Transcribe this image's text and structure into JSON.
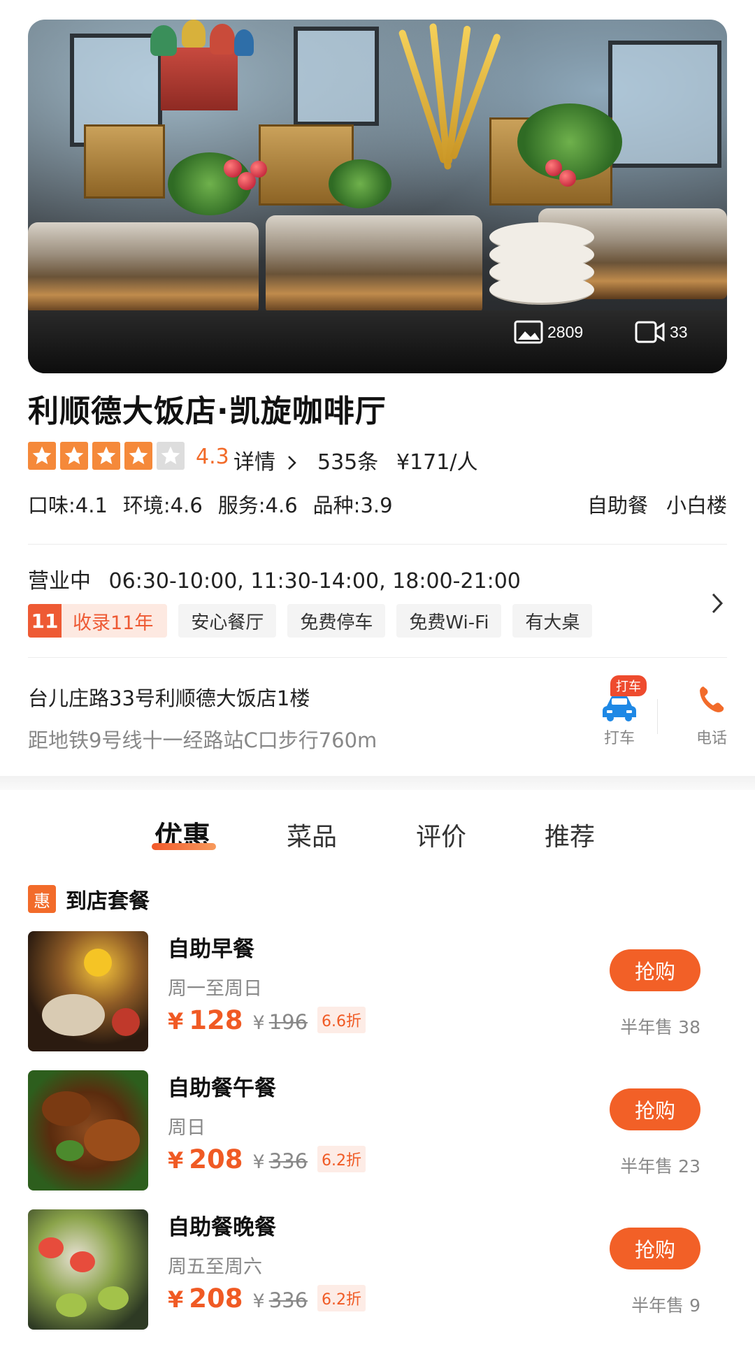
{
  "hero": {
    "photo_count": "2809",
    "video_count": "33"
  },
  "restaurant": {
    "name": "利顺德大饭店·凯旋咖啡厅",
    "rating": "4.3",
    "stars": 4,
    "detail_link": "详情",
    "review_count": "535条",
    "avg_price": "¥171/人",
    "subscores": [
      "口味:4.1",
      "环境:4.6",
      "服务:4.6",
      "品种:3.9"
    ],
    "category": "自助餐",
    "area": "小白楼"
  },
  "hours": {
    "status": "营业中",
    "times": "06:30-10:00, 11:30-14:00, 18:00-21:00"
  },
  "badges": {
    "years_num": "11",
    "years_text": "收录11年",
    "features": [
      "安心餐厅",
      "免费停车",
      "免费Wi-Fi",
      "有大桌"
    ]
  },
  "location": {
    "address": "台儿庄路33号利顺德大饭店1楼",
    "metro": "距地铁9号线十一经路站C口步行760m",
    "taxi_badge": "打车",
    "taxi_label": "打车",
    "phone_label": "电话"
  },
  "tabs": [
    "优惠",
    "菜品",
    "评价",
    "推荐"
  ],
  "section": {
    "icon_text": "惠",
    "title": "到店套餐"
  },
  "deals": [
    {
      "name": "自助早餐",
      "days": "周一至周日",
      "currency": "¥",
      "price": "128",
      "old_price": "196",
      "discount": "6.6折",
      "buy": "抢购",
      "sold": "半年售 38"
    },
    {
      "name": "自助餐午餐",
      "days": "周日",
      "currency": "¥",
      "price": "208",
      "old_price": "336",
      "discount": "6.2折",
      "buy": "抢购",
      "sold": "半年售 23"
    },
    {
      "name": "自助餐晚餐",
      "days": "周五至周六",
      "currency": "¥",
      "price": "208",
      "old_price": "336",
      "discount": "6.2折",
      "buy": "抢购",
      "sold": "半年售 9"
    }
  ],
  "colors": {
    "accent": "#f26b2a",
    "star": "#f5893a",
    "star_empty": "#dddddd"
  }
}
